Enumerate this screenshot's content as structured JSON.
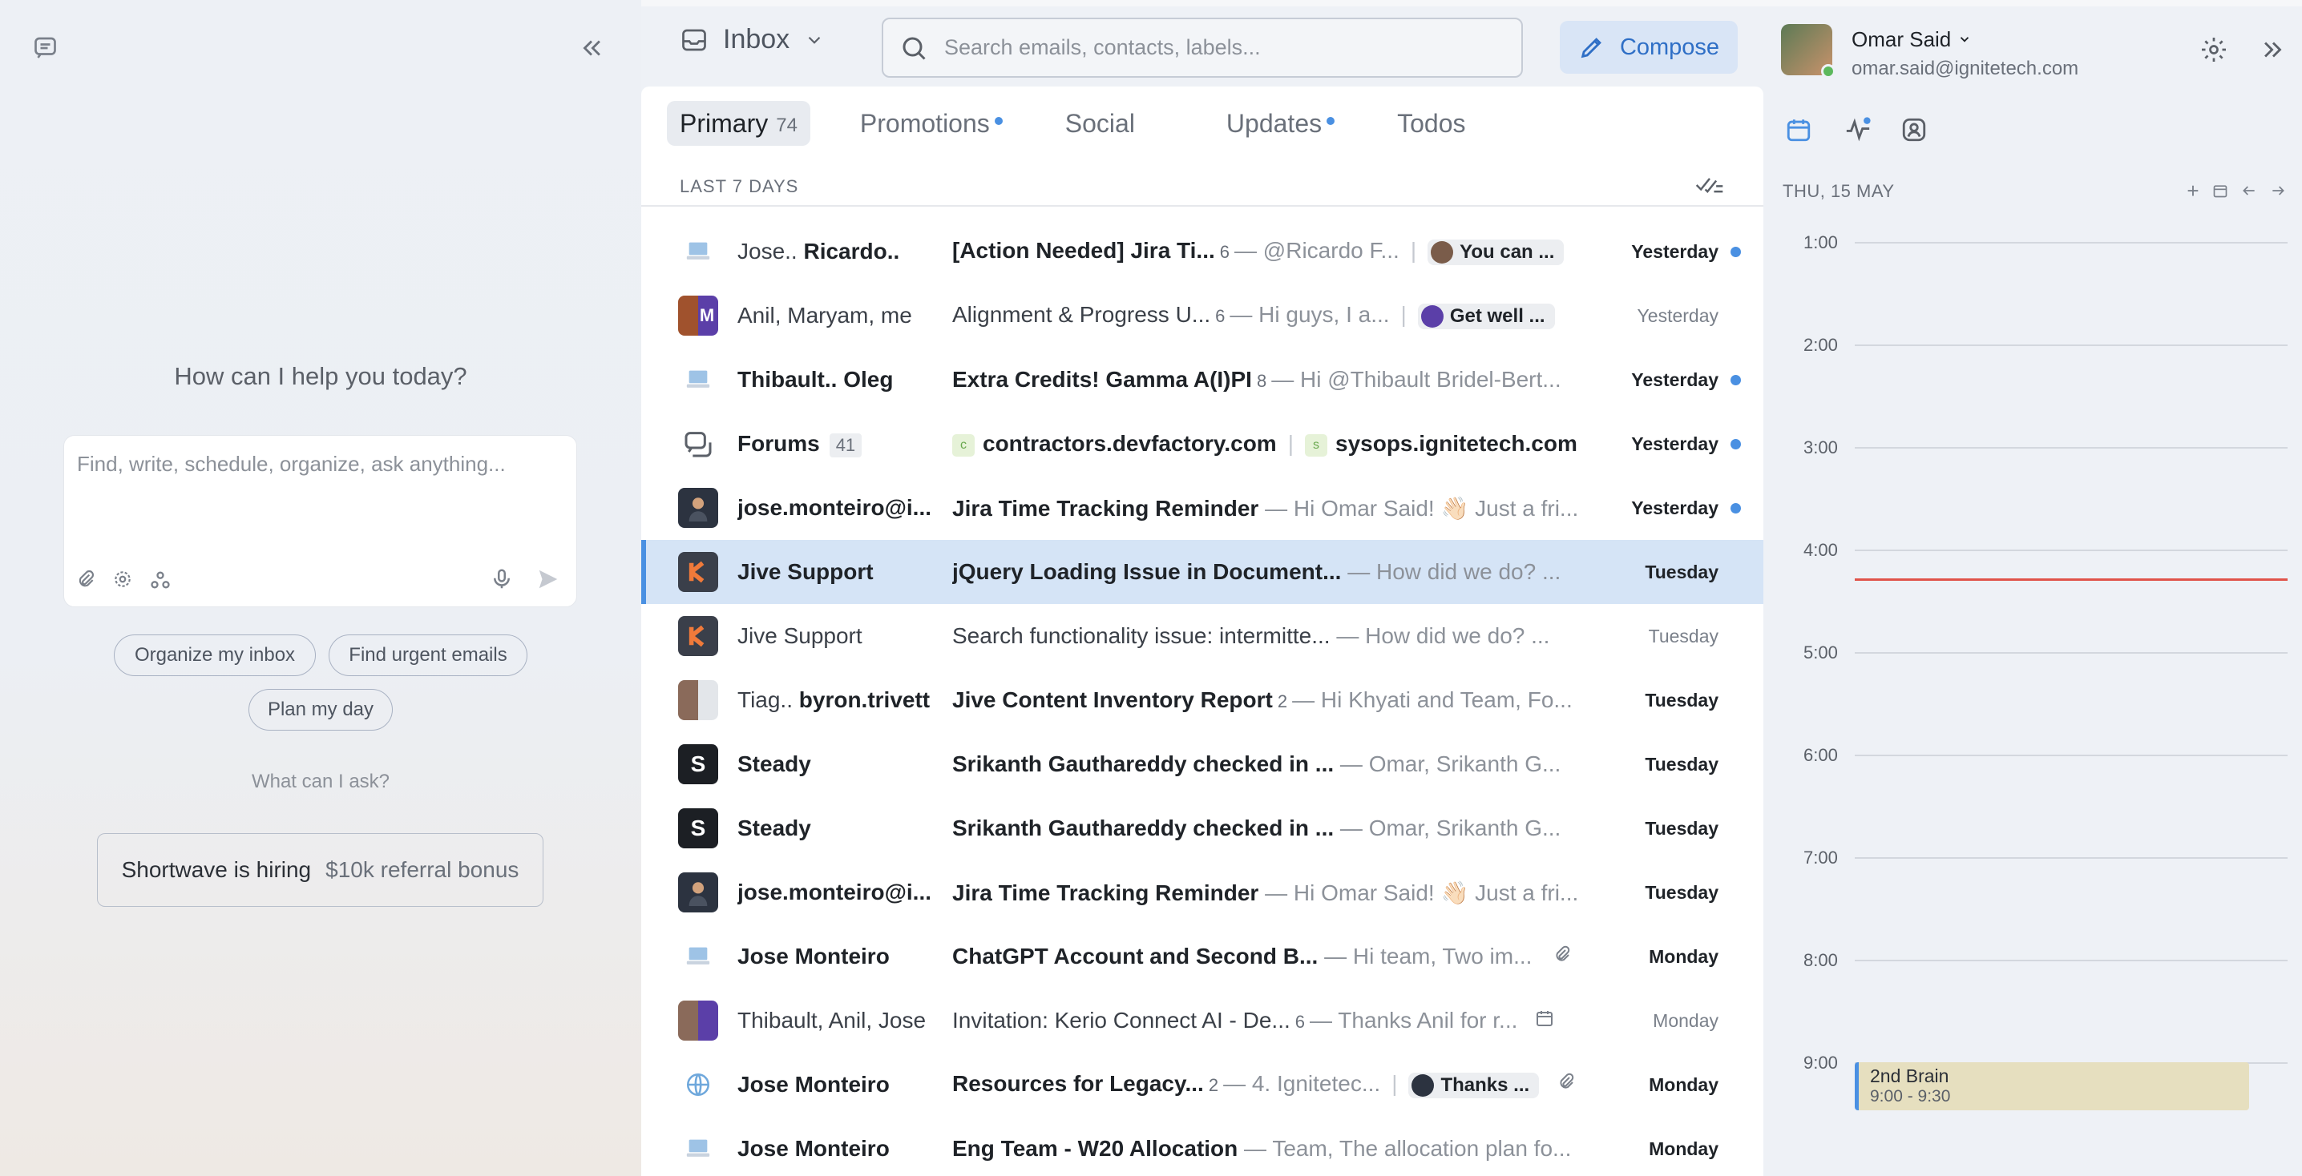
{
  "assistant": {
    "title": "How can I help you today?",
    "input_placeholder": "Find, write, schedule, organize, ask anything...",
    "chips": [
      "Organize my inbox",
      "Find urgent emails",
      "Plan my day"
    ],
    "what_can_i_ask": "What can I ask?",
    "hiring_text": "Shortwave is hiring",
    "hiring_bonus": "$10k referral bonus"
  },
  "header": {
    "inbox_label": "Inbox",
    "search_placeholder": "Search emails, contacts, labels...",
    "compose_label": "Compose"
  },
  "tabs": {
    "primary": "Primary",
    "primary_count": "74",
    "promotions": "Promotions",
    "social": "Social",
    "updates": "Updates",
    "todos": "Todos"
  },
  "section_label": "LAST 7 DAYS",
  "emails": [
    {
      "sender_pre": "Jose.. ",
      "sender": "Ricardo..",
      "subject": "[Action Needed] Jira Ti...",
      "count": "6",
      "preview": "— @Ricardo F...",
      "pill": "You can ...",
      "date": "Yesterday",
      "unread": true
    },
    {
      "sender_pre": "Anil, Maryam, me",
      "sender": "",
      "subject": "Alignment & Progress U...",
      "count": "6",
      "preview": "— Hi guys, I a...",
      "pill": "Get well ...",
      "date": "Yesterday",
      "unread": false
    },
    {
      "sender_pre": "",
      "sender": "Thibault.. Oleg",
      "subject": "Extra Credits! Gamma A(I)PI",
      "count": "8",
      "preview": "— Hi @Thibault Bridel-Bert...",
      "pill": "",
      "date": "Yesterday",
      "unread": true
    },
    {
      "sender_pre": "",
      "sender": "Forums",
      "forum_count": "41",
      "subject": "contractors.devfactory.com",
      "subject2": "sysops.ignitetech.com",
      "tag1": "c",
      "tag2": "s",
      "count": "",
      "preview": "",
      "pill": "",
      "date": "Yesterday",
      "unread": true
    },
    {
      "sender_pre": "",
      "sender": "jose.monteiro@i...",
      "subject": "Jira Time Tracking Reminder",
      "count": "",
      "preview": "— Hi Omar Said! 👋🏻 Just a fri...",
      "pill": "",
      "date": "Yesterday",
      "unread": true
    },
    {
      "sender_pre": "",
      "sender": "Jive Support",
      "subject": "jQuery Loading Issue in Document...",
      "count": "",
      "preview": "— How did we do? ...",
      "pill": "",
      "date": "Tuesday",
      "unread": true
    },
    {
      "sender_pre": "Jive Support",
      "sender": "",
      "subject": "Search functionality issue: intermitte...",
      "count": "",
      "preview": "— How did we do? ...",
      "pill": "",
      "date": "Tuesday",
      "unread": false
    },
    {
      "sender_pre": "Tiag.. ",
      "sender": "byron.trivett",
      "subject": "Jive Content Inventory Report",
      "count": "2",
      "preview": "— Hi Khyati and Team, Fo...",
      "pill": "",
      "date": "Tuesday",
      "unread": true
    },
    {
      "sender_pre": "",
      "sender": "Steady",
      "subject": "Srikanth Gauthareddy checked in ...",
      "count": "",
      "preview": "— Omar, Srikanth G...",
      "pill": "",
      "date": "Tuesday",
      "unread": true
    },
    {
      "sender_pre": "",
      "sender": "Steady",
      "subject": "Srikanth Gauthareddy checked in ...",
      "count": "",
      "preview": "— Omar, Srikanth G...",
      "pill": "",
      "date": "Tuesday",
      "unread": true
    },
    {
      "sender_pre": "",
      "sender": "jose.monteiro@i...",
      "subject": "Jira Time Tracking Reminder",
      "count": "",
      "preview": "— Hi Omar Said! 👋🏻 Just a fri...",
      "pill": "",
      "date": "Tuesday",
      "unread": true
    },
    {
      "sender_pre": "",
      "sender": "Jose Monteiro",
      "subject": "ChatGPT Account and Second B...",
      "count": "",
      "preview": "— Hi team, Two im...",
      "pill": "",
      "date": "Monday",
      "unread": true,
      "icon": "paperclip"
    },
    {
      "sender_pre": "Thibault, Anil, Jose",
      "sender": "",
      "subject": "Invitation: Kerio Connect AI - De...",
      "count": "6",
      "preview": "— Thanks Anil for r...",
      "pill": "",
      "date": "Monday",
      "unread": false,
      "icon": "calendar"
    },
    {
      "sender_pre": "",
      "sender": "Jose Monteiro",
      "subject": "Resources for Legacy...",
      "count": "2",
      "preview": "— 4. Ignitetec...",
      "pill": "Thanks ...",
      "date": "Monday",
      "unread": true,
      "icon": "paperclip"
    },
    {
      "sender_pre": "",
      "sender": "Jose Monteiro",
      "subject": "Eng Team - W20 Allocation",
      "count": "",
      "preview": "— Team, The allocation plan fo...",
      "pill": "",
      "date": "Monday",
      "unread": true
    }
  ],
  "profile": {
    "name": "Omar Said",
    "email": "omar.said@ignitetech.com"
  },
  "calendar": {
    "date_label": "THU, 15 MAY",
    "hours": [
      "1:00",
      "2:00",
      "3:00",
      "4:00",
      "5:00",
      "6:00",
      "7:00",
      "8:00",
      "9:00"
    ],
    "event_title": "2nd Brain",
    "event_time": "9:00 - 9:30"
  },
  "colors": {
    "accent": "#4a90e2",
    "selected_row": "#d5e4f6",
    "now_line": "#e0534a",
    "event_bg": "#e6dfbf"
  }
}
